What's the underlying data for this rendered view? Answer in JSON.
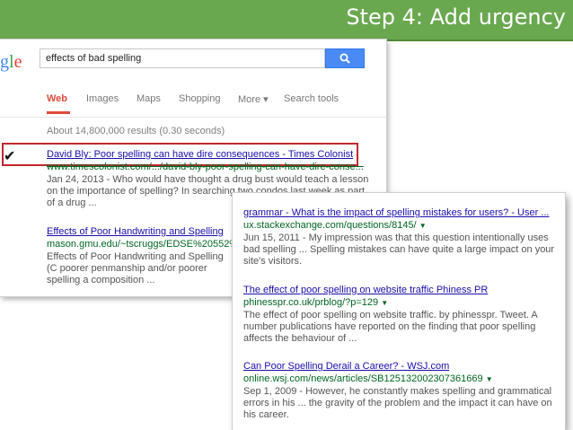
{
  "slide": {
    "title": "Step 4: Add urgency"
  },
  "google": {
    "logo_text": "gle",
    "query": "effects of bad spelling",
    "tabs": [
      "Web",
      "Images",
      "Maps",
      "Shopping",
      "More ▾",
      "Search tools"
    ],
    "stats": "About 14,800,000 results (0.30 seconds)"
  },
  "results_left": [
    {
      "title": "David Bly: Poor spelling can have dire consequences - Times Colonist",
      "url": "www.timescolonist.com/.../david-bly-poor-spelling-can-have-dire-conse...",
      "date": "Jan 24, 2013",
      "snippet": "Jan 24, 2013 - Who would have thought a drug bust would teach a lesson on the importance of spelling? In searching two condos last week as part of a drug ..."
    },
    {
      "title": "Effects of Poor Handwriting and Spelling",
      "url": "mason.gmu.edu/~tscruggs/EDSE%20552%2",
      "snippet": "Effects of Poor Handwriting and Spelling (C poorer penmanship and/or poorer spelling a composition ..."
    }
  ],
  "results_right": [
    {
      "title": "grammar - What is the impact of spelling mistakes for users? - User ...",
      "url": "ux.stackexchange.com/questions/8145/",
      "snippet": "Jun 15, 2011 - My impression was that this question intentionally uses bad spelling ... Spelling mistakes can have quite a large impact on your site's visitors."
    },
    {
      "title": "The effect of poor spelling on website traffic Phiness PR",
      "url": "phinesspr.co.uk/prblog/?p=129",
      "snippet": "The effect of poor spelling on website traffic. by phinesspr. Tweet. A number publications have reported on the finding that poor spelling affects the behaviour of ..."
    },
    {
      "title": "Can Poor Spelling Derail a Career? - WSJ.com",
      "url": "online.wsj.com/news/articles/SB125132002307361669",
      "snippet": "Sep 1, 2009 - However, he constantly makes spelling and grammatical errors in his ... the gravity of the problem and the impact it can have on his career."
    }
  ],
  "colors": {
    "banner": "#6aa84f",
    "highlight_box": "#c0282d",
    "link": "#1a0dab",
    "url": "#006621"
  },
  "icons": [
    "checkmark-icon",
    "search-icon",
    "dropdown-caret-icon"
  ]
}
